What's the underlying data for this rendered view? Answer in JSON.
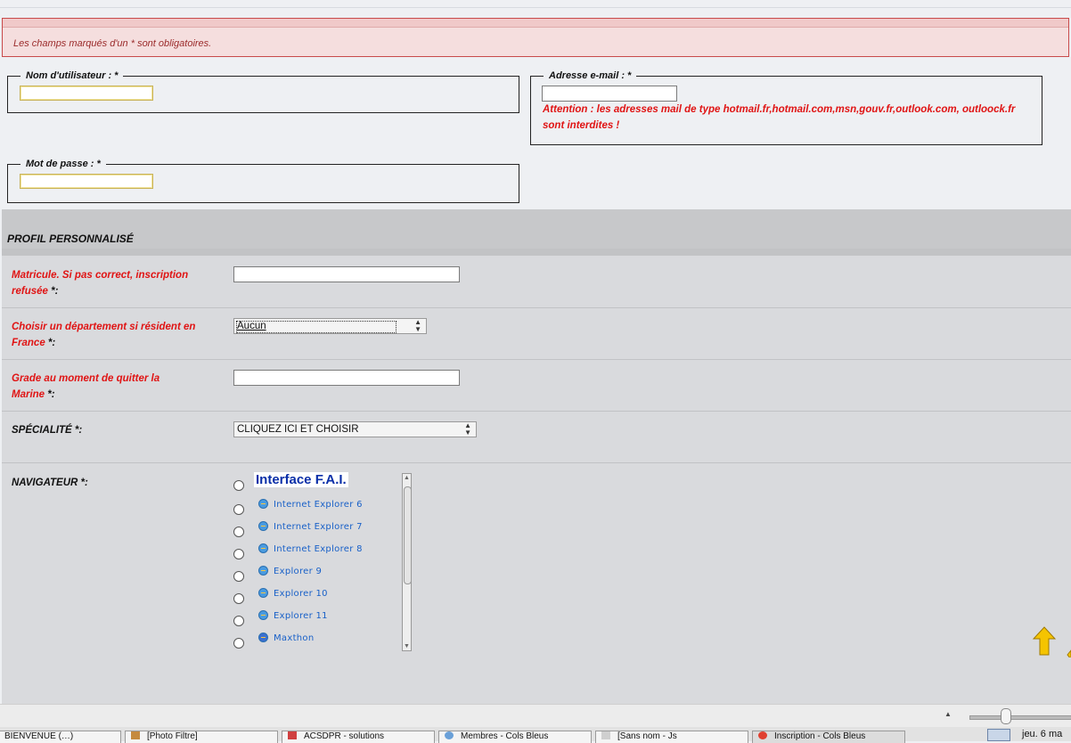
{
  "notice": {
    "text": "Les champs marqués d'un * sont obligatoires."
  },
  "account": {
    "username_legend": "Nom d'utilisateur : *",
    "password_legend": "Mot de passe : *",
    "email_legend": "Adresse e-mail : *",
    "email_warning": "Attention : les adresses mail de type hotmail.fr,hotmail.com,msn,gouv.fr,outlook.com, outloock.fr sont interdites !",
    "username_value": "",
    "password_value": "",
    "email_value": ""
  },
  "profile": {
    "title": "PROFIL PERSONNALISÉ",
    "matricule_label_red": "Matricule. Si pas correct, inscription refusée",
    "matricule_label_tail": " *:",
    "departement_label_red": "Choisir un département si résident en France",
    "departement_label_tail": " *:",
    "departement_selected": "Aucun",
    "grade_label_red": "Grade au moment de quitter la Marine",
    "grade_label_tail": " *:",
    "specialite_label": "SPÉCIALITÉ *:",
    "specialite_selected": "CLIQUEZ ICI ET CHOISIR",
    "navigateur_label": "NAVIGATEUR *:",
    "browser_options": [
      "Interface F.A.I.",
      "Internet Explorer  6",
      "Internet Explorer  7",
      "Internet Explorer  8",
      "Explorer  9",
      "Explorer  10",
      "Explorer  11",
      "Maxthon"
    ]
  },
  "taskbar": {
    "tabs": [
      "BIENVENUE (…)",
      "[Photo Filtre]",
      "ACSDPR - solutions",
      "Membres - Cols Bleus",
      "[Sans nom - Js",
      "Inscription - Cols Bleus"
    ],
    "clock": "jeu. 6 ma"
  },
  "colors": {
    "required_red": "#e01414",
    "notice_bg": "#f5dede",
    "section_bg": "#d9dadd"
  }
}
